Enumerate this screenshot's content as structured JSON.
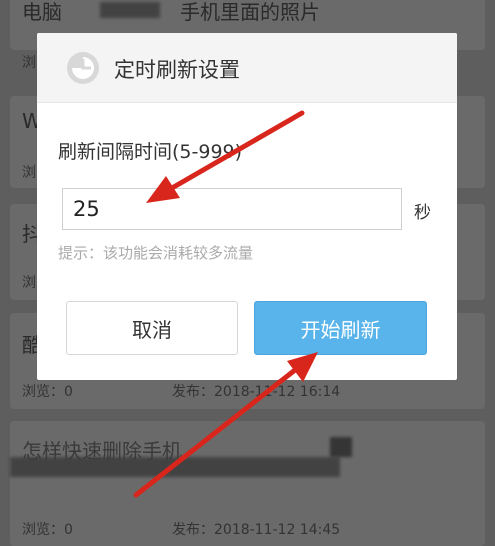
{
  "background_list": {
    "cards": [
      {
        "title": "电脑",
        "title2": "手机里面的照片",
        "meta_label": "浏"
      },
      {
        "title": "W",
        "meta_label": "浏"
      },
      {
        "title": "抖",
        "meta_label": "浏"
      },
      {
        "title": "酷",
        "meta_label": "浏览：0",
        "publish": "发布：2018-11-12 16:14"
      },
      {
        "title": "怎样快速删除手机",
        "meta_label": "浏览：0",
        "publish": "发布：2018-11-12 14:45"
      }
    ]
  },
  "dialog": {
    "icon": "clock-icon",
    "title": "定时刷新设置",
    "field_label": "刷新间隔时间(5-999)",
    "interval_value": "25",
    "unit": "秒",
    "hint": "提示：该功能会消耗较多流量",
    "cancel_label": "取消",
    "start_label": "开始刷新"
  },
  "colors": {
    "accent": "#58b4ea",
    "annotation_arrow": "#d9261c",
    "dim_overlay": "#5e5e5e"
  }
}
